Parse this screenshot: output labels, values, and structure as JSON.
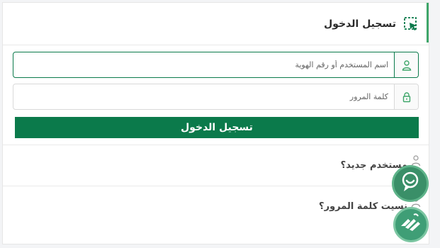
{
  "header": {
    "title": "تسجيل الدخول",
    "icon": "login-pointer-icon"
  },
  "form": {
    "username_placeholder": "اسم المستخدم أو رقم الهوية",
    "username_value": "",
    "username_icon": "user-icon",
    "password_placeholder": "كلمة المرور",
    "password_value": "",
    "password_icon": "lock-icon",
    "submit_label": "تسجيل الدخول"
  },
  "links": {
    "new_user": "مستخدم جديد؟",
    "forgot_password": "نسيت كلمة المرور؟"
  },
  "floating": {
    "chat_icon": "support-chat-icon",
    "sign_language_icon": "sign-language-icon"
  },
  "colors": {
    "primary": "#0b7a4b",
    "accent": "#3fa66a"
  }
}
